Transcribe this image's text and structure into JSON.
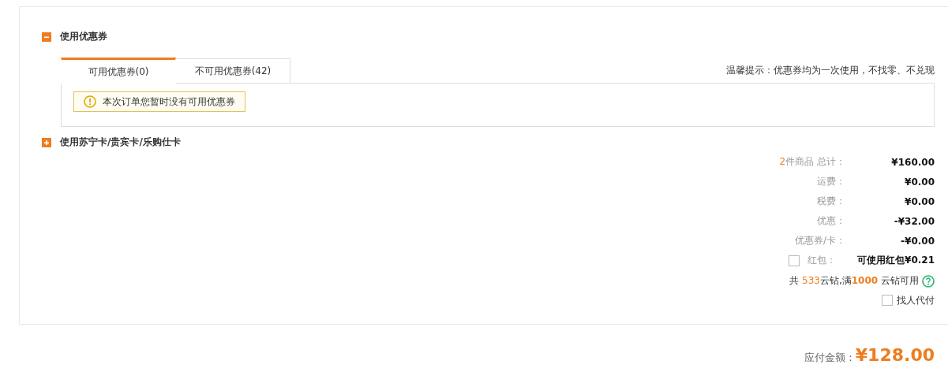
{
  "coupon_section": {
    "title": "使用优惠券",
    "expanded": true,
    "tabs": [
      {
        "label": "可用优惠券(0)",
        "selected": true
      },
      {
        "label": "不可用优惠券(42)",
        "selected": false
      }
    ],
    "tip": "温馨提示：优惠券均为一次使用，不找零、不兑现",
    "notice": "本次订单您暂时没有可用优惠券"
  },
  "card_section": {
    "title": "使用苏宁卡/贵宾卡/乐购仕卡",
    "expanded": false
  },
  "summary": {
    "rows": [
      {
        "kind": "count",
        "count": "2",
        "label": "件商品 总计：",
        "value": "¥160.00"
      },
      {
        "kind": "plain",
        "label": "运费：",
        "value": "¥0.00"
      },
      {
        "kind": "plain",
        "label": "税费：",
        "value": "¥0.00"
      },
      {
        "kind": "plain",
        "label": "优惠：",
        "value": "-¥32.00"
      },
      {
        "kind": "plain",
        "label": "优惠券/卡：",
        "value": "-¥0.00"
      },
      {
        "kind": "check",
        "checked": false,
        "label": "红包：",
        "value": "可使用红包¥0.21"
      }
    ],
    "points": {
      "prefix": "共",
      "count": "533",
      "middle": "云钻,满",
      "threshold": "1000",
      "suffix": "云钻可用"
    },
    "pay_for_me": {
      "label": "找人代付",
      "checked": false
    }
  },
  "total": {
    "label": "应付金额：",
    "value": "¥128.00"
  }
}
